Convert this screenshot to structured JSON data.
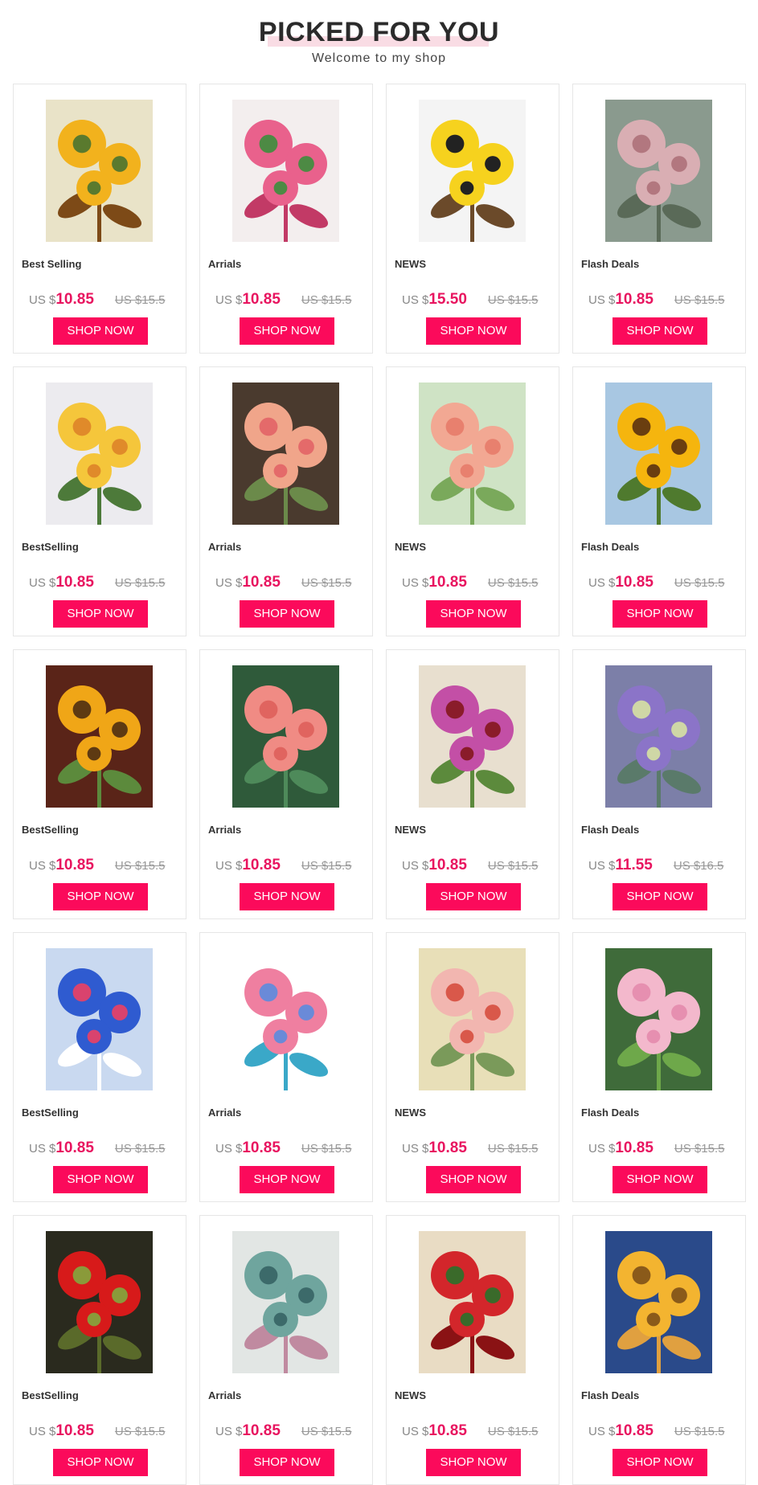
{
  "header": {
    "title": "PICKED FOR YOU",
    "subtitle": "Welcome to my shop"
  },
  "theme": {
    "accent": "#fb0a5b",
    "price_color": "#e8145f",
    "highlight": "#f9dce4"
  },
  "products": [
    {
      "category": "Best Selling",
      "currency": "US $",
      "price": "10.85",
      "old_price": "US $15.5",
      "button": "SHOP NOW",
      "image": "sunflowers-painting",
      "palette": [
        "#e9e3c8",
        "#f2b21d",
        "#5a7a2e",
        "#7d4a17"
      ]
    },
    {
      "category": "Arrials",
      "currency": "US $",
      "price": "10.85",
      "old_price": "US $15.5",
      "button": "SHOP NOW",
      "image": "pink-peonies-painting",
      "palette": [
        "#f3eeee",
        "#e9618c",
        "#4d8a44",
        "#c23a66"
      ]
    },
    {
      "category": "NEWS",
      "currency": "US $",
      "price": "15.50",
      "old_price": "US $15.5",
      "button": "SHOP NOW",
      "image": "good-morning-coffee-cup",
      "palette": [
        "#f4f4f4",
        "#f6d21e",
        "#222222",
        "#6b4a2a"
      ]
    },
    {
      "category": "Flash Deals",
      "currency": "US $",
      "price": "10.85",
      "old_price": "US $15.5",
      "button": "SHOP NOW",
      "image": "pink-iris-painting",
      "palette": [
        "#8a9a8e",
        "#d9aeb3",
        "#b2777f",
        "#5a6a58"
      ]
    },
    {
      "category": "BestSelling",
      "currency": "US $",
      "price": "10.85",
      "old_price": "US $15.5",
      "button": "SHOP NOW",
      "image": "yellow-roses-painting",
      "palette": [
        "#ecebef",
        "#f5c63b",
        "#e08a2a",
        "#4d7a3a"
      ]
    },
    {
      "category": "Arrials",
      "currency": "US $",
      "price": "10.85",
      "old_price": "US $15.5",
      "button": "SHOP NOW",
      "image": "roses-butterflies-painting",
      "palette": [
        "#4a3a2e",
        "#f0a58a",
        "#e46a6a",
        "#6b8a4a"
      ]
    },
    {
      "category": "NEWS",
      "currency": "US $",
      "price": "10.85",
      "old_price": "US $15.5",
      "button": "SHOP NOW",
      "image": "peach-roses-painting",
      "palette": [
        "#cfe3c5",
        "#f2a893",
        "#e8806e",
        "#7aa95b"
      ]
    },
    {
      "category": "Flash Deals",
      "currency": "US $",
      "price": "10.85",
      "old_price": "US $15.5",
      "button": "SHOP NOW",
      "image": "sunflowers-sky-painting",
      "palette": [
        "#a8c7e2",
        "#f5b50e",
        "#6a3e10",
        "#4f7a2e"
      ]
    },
    {
      "category": "BestSelling",
      "currency": "US $",
      "price": "10.85",
      "old_price": "US $15.5",
      "button": "SHOP NOW",
      "image": "sunflowers-dark-painting",
      "palette": [
        "#5a2418",
        "#f0a617",
        "#5e3a12",
        "#5c8a3c"
      ]
    },
    {
      "category": "Arrials",
      "currency": "US $",
      "price": "10.85",
      "old_price": "US $15.5",
      "button": "SHOP NOW",
      "image": "coral-roses-painting",
      "palette": [
        "#2f5a3a",
        "#f08b84",
        "#e0645f",
        "#4e8a5a"
      ]
    },
    {
      "category": "NEWS",
      "currency": "US $",
      "price": "10.85",
      "old_price": "US $15.5",
      "button": "SHOP NOW",
      "image": "lilies-butterfly-painting",
      "palette": [
        "#e8dfcf",
        "#c34fa6",
        "#8a1c2a",
        "#5c8a3c"
      ]
    },
    {
      "category": "Flash Deals",
      "currency": "US $",
      "price": "11.55",
      "old_price": "US $16.5",
      "button": "SHOP NOW",
      "image": "lotus-dragonfly-painting",
      "palette": [
        "#7c7fa8",
        "#8b74c8",
        "#cfd7a6",
        "#5a7a6a"
      ]
    },
    {
      "category": "BestSelling",
      "currency": "US $",
      "price": "10.85",
      "old_price": "US $15.5",
      "button": "SHOP NOW",
      "image": "blue-pink-flowers-painting",
      "palette": [
        "#c9d9f0",
        "#2f5bd0",
        "#d9436e",
        "#ffffff"
      ]
    },
    {
      "category": "Arrials",
      "currency": "US $",
      "price": "10.85",
      "old_price": "US $15.5",
      "button": "SHOP NOW",
      "image": "watercolor-florals-set",
      "palette": [
        "#ffffff",
        "#ef7fa0",
        "#6a8ad8",
        "#3aa8c8"
      ]
    },
    {
      "category": "NEWS",
      "currency": "US $",
      "price": "10.85",
      "old_price": "US $15.5",
      "button": "SHOP NOW",
      "image": "rose-bouquet-painting",
      "palette": [
        "#e8dfb8",
        "#f2b6b0",
        "#d9584a",
        "#7a9a5a"
      ]
    },
    {
      "category": "Flash Deals",
      "currency": "US $",
      "price": "10.85",
      "old_price": "US $15.5",
      "button": "SHOP NOW",
      "image": "pink-orchids-painting",
      "palette": [
        "#3f6b3a",
        "#f3b8cc",
        "#e68fb0",
        "#6ea84a"
      ]
    },
    {
      "category": "BestSelling",
      "currency": "US $",
      "price": "10.85",
      "old_price": "US $15.5",
      "button": "SHOP NOW",
      "image": "red-rose-dark-painting",
      "palette": [
        "#2a2a1e",
        "#d71a1a",
        "#8a9a3a",
        "#5a6a2a"
      ]
    },
    {
      "category": "Arrials",
      "currency": "US $",
      "price": "10.85",
      "old_price": "US $15.5",
      "button": "SHOP NOW",
      "image": "succulents-birdcage-painting",
      "palette": [
        "#e2e6e4",
        "#6fa59e",
        "#3c6a6a",
        "#c08aa0"
      ]
    },
    {
      "category": "NEWS",
      "currency": "US $",
      "price": "10.85",
      "old_price": "US $15.5",
      "button": "SHOP NOW",
      "image": "red-rose-sheet-music",
      "palette": [
        "#e9dcc4",
        "#d3262b",
        "#3a6a2a",
        "#8a1214"
      ]
    },
    {
      "category": "Flash Deals",
      "currency": "US $",
      "price": "10.85",
      "old_price": "US $15.5",
      "button": "SHOP NOW",
      "image": "sunflower-dragonfly-painting",
      "palette": [
        "#2a4a8a",
        "#f3b430",
        "#8a5a1a",
        "#e0a040"
      ]
    }
  ]
}
